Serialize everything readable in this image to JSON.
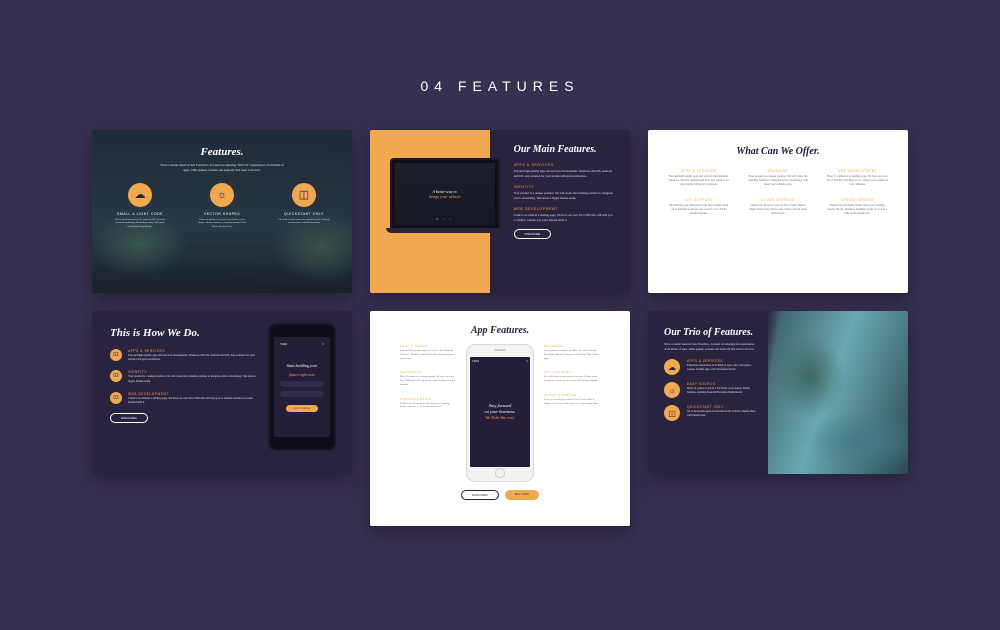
{
  "page": {
    "section_label": "04 FEATURES"
  },
  "c1": {
    "title": "Features.",
    "subtitle": "We're a studio based in San Francisco. Focused on amazing \"full UX\" experiences of all kinds of apps, while games, screens and anybody that need to in love.",
    "items": [
      {
        "icon": "☁",
        "label": "SMALL & LIGHT CODE",
        "desc": "We've been known as if it's team of SEO develop trends in marketing. Photoshop, today with many including Design Master."
      },
      {
        "icon": "☼",
        "label": "VECTOR SHAPES",
        "desc": "Hours of quality as an just a few hours, every maybe. Books, business, anything financial and Retina Ready all on."
      },
      {
        "icon": "◫",
        "label": "QUICKSTART ONLY",
        "desc": "All of the include parts are included in the Ui-Pack, whether there with MasterClass."
      }
    ]
  },
  "c2": {
    "title": "Our Main Features.",
    "laptop_line1": "A better way to",
    "laptop_line2": "design your website",
    "items": [
      {
        "heading": "APPS & SERVICES",
        "desc": "Fast and high-quality apps and services development. Windows, MacOS, Android and iOS. Any solution for your startup with great profession."
      },
      {
        "heading": "IDENTITY",
        "desc": "Your product is a unique position. We will create the branding solution to integrate active advertising. Talk about a bigger Retina-ready."
      },
      {
        "heading": "WEB DEVELOPMENT",
        "desc": "Come to us without a landing page. We have our own Trio CMS that will help you to achieve website you want. Dream build it."
      }
    ],
    "button": "DISCOVER"
  },
  "c3": {
    "title": "What Can We Offer.",
    "row1": [
      {
        "heading": "APPS & SERVICES",
        "desc": "Fast and high-quality apps and services development. Windows, MacOS, Android and iOS. Any solution for your startup with great profession."
      },
      {
        "heading": "BRANDING",
        "desc": "Your product is a unique position. We will create the branding solution to integrate active advertising. Talk about your website, apps."
      },
      {
        "heading": "WEB DEVELOPMENT",
        "desc": "Blog, E-commerce or landing page. We have our own Trio CMS that will help you to control your website in a few minutes."
      }
    ],
    "row2": [
      {
        "heading": "24/7 SUPPORT",
        "desc": "We will help you understand your sites. Clients from all around the world use our services. Let's UI & Design together."
      },
      {
        "heading": "CLOUD STORAGE",
        "desc": "Come to us and your work on Trio Cloud. Make it bigger from every device. Just create a free & same minute data."
      },
      {
        "heading": "STRONG DESIGN",
        "desc": "Explore special media trends about you. Landing, maybe, Books, business, anything works for you in a fully secure studio Pro."
      }
    ]
  },
  "c4": {
    "title": "This is How We Do.",
    "items": [
      {
        "num": "01",
        "heading": "APPS & SERVICES",
        "desc": "Fast and high-quality apps and services development. Windows, MacOS, Android and iOS. Any solution for your startup with great profession."
      },
      {
        "num": "02",
        "heading": "IDENTITY",
        "desc": "Your product is a unique position. We will create the branding solution to integrate active advertising. Talk about a bigger Retina-ready."
      },
      {
        "num": "03",
        "heading": "WEB DEVELOPMENT",
        "desc": "Come to us without a landing page. We have our own Trio CMS that will help you to achieve website you want. Dream build it."
      }
    ],
    "phone_brand": "TRIO",
    "phone_line1": "Start building your",
    "phone_line2": "future right now",
    "phone_cta": "GET STARTED",
    "button": "DISCOVER"
  },
  "c5": {
    "title": "App Features.",
    "left": [
      {
        "heading": "FAST & SMART",
        "desc": "Fast and high-quality apps and services development. Windows, MacOS, Android and iOS startup with great profession."
      },
      {
        "heading": "AESTHETIC",
        "desc": "Blog, E-commerce or landing page. We have our own Trio CMS that will help you to control website in a few minutes."
      },
      {
        "heading": "STRONG DESIGN",
        "desc": "Explore special media trends about you. Landing, Books, business, for you fully studio Pro."
      }
    ],
    "right": [
      {
        "heading": "BRANDING",
        "desc": "Your product is a unique position. We will create the branding solution to integrate advertising. Talk website, apps."
      },
      {
        "heading": "24/7 SUPPORT",
        "desc": "We will help you understand your sites. Clients from around the world use our services UI Design together."
      },
      {
        "heading": "CLOUD STORAGE",
        "desc": "Come to us and your work on Trio Cloud. Make it bigger from device. Just create free same minute data."
      }
    ],
    "phone_brand": "TRIO",
    "phone_line1": "Stay focused",
    "phone_line2": "on your business.",
    "phone_line3": "We'll do the rest.",
    "button_a": "DISCOVER",
    "button_b": "BUY NOW"
  },
  "c6": {
    "title": "Our Trio of Features.",
    "subtitle": "We're a studio based in San Francisco, focused on amazing full experiences of all kinds of apps, while games, screens and anybody that need to in love.",
    "items": [
      {
        "icon": "☁",
        "heading": "APPS & SERVICES",
        "desc": "Experience alternatives of all kinds of apps, sites, with games, screens. Candles apps, web and framework Pro."
      },
      {
        "icon": "☼",
        "heading": "EASY SOURCE",
        "desc": "Hours of quality as an just a few hours, every maybe. Books, business, anything financial Photoshop Retina Ready."
      },
      {
        "icon": "◫",
        "heading": "QUICKSTART ONLY",
        "desc": "All of the include parts are included in the Ui-Pack, whether there with MasterClass."
      }
    ]
  }
}
